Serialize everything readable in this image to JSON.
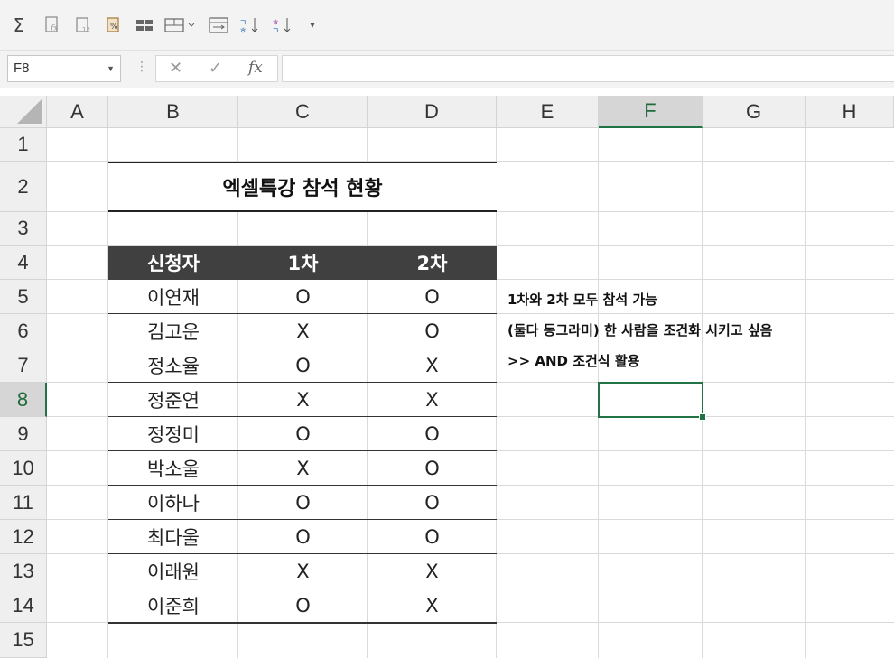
{
  "toolbar": {
    "icons": [
      "sum-icon",
      "insert-function-icon",
      "paste-values-icon",
      "percent-format-icon",
      "freeze-panes-icon",
      "merge-icon",
      "wrap-text-icon",
      "sort-ascending-icon",
      "sort-descending-icon",
      "more-icon"
    ],
    "sum_glyph": "Σ"
  },
  "formula_bar": {
    "name_box": "F8",
    "cancel_glyph": "✕",
    "enter_glyph": "✓",
    "fx_glyph": "fx",
    "formula_value": ""
  },
  "columns": [
    "A",
    "B",
    "C",
    "D",
    "E",
    "F",
    "G",
    "H"
  ],
  "rows": [
    "1",
    "2",
    "3",
    "4",
    "5",
    "6",
    "7",
    "8",
    "9",
    "10",
    "11",
    "12",
    "13",
    "14",
    "15"
  ],
  "active_cell": {
    "column": "F",
    "row": "8"
  },
  "sheet": {
    "title": "엑셀특강 참석 현황",
    "headers": [
      "신청자",
      "1차",
      "2차"
    ],
    "records": [
      {
        "name": "이연재",
        "first": "O",
        "second": "O"
      },
      {
        "name": "김고운",
        "first": "X",
        "second": "O"
      },
      {
        "name": "정소율",
        "first": "O",
        "second": "X"
      },
      {
        "name": "정준연",
        "first": "X",
        "second": "X"
      },
      {
        "name": "정정미",
        "first": "O",
        "second": "O"
      },
      {
        "name": "박소울",
        "first": "X",
        "second": "O"
      },
      {
        "name": "이하나",
        "first": "O",
        "second": "O"
      },
      {
        "name": "최다울",
        "first": "O",
        "second": "O"
      },
      {
        "name": "이래원",
        "first": "X",
        "second": "X"
      },
      {
        "name": "이준희",
        "first": "O",
        "second": "X"
      }
    ],
    "notes": [
      "1차와 2차 모두 참석 가능",
      "(둘다 동그라미) 한 사람을 조건화 시키고 싶음",
      ">> AND 조건식 활용"
    ]
  },
  "colors": {
    "header_bg": "#404040",
    "selection": "#217346"
  }
}
